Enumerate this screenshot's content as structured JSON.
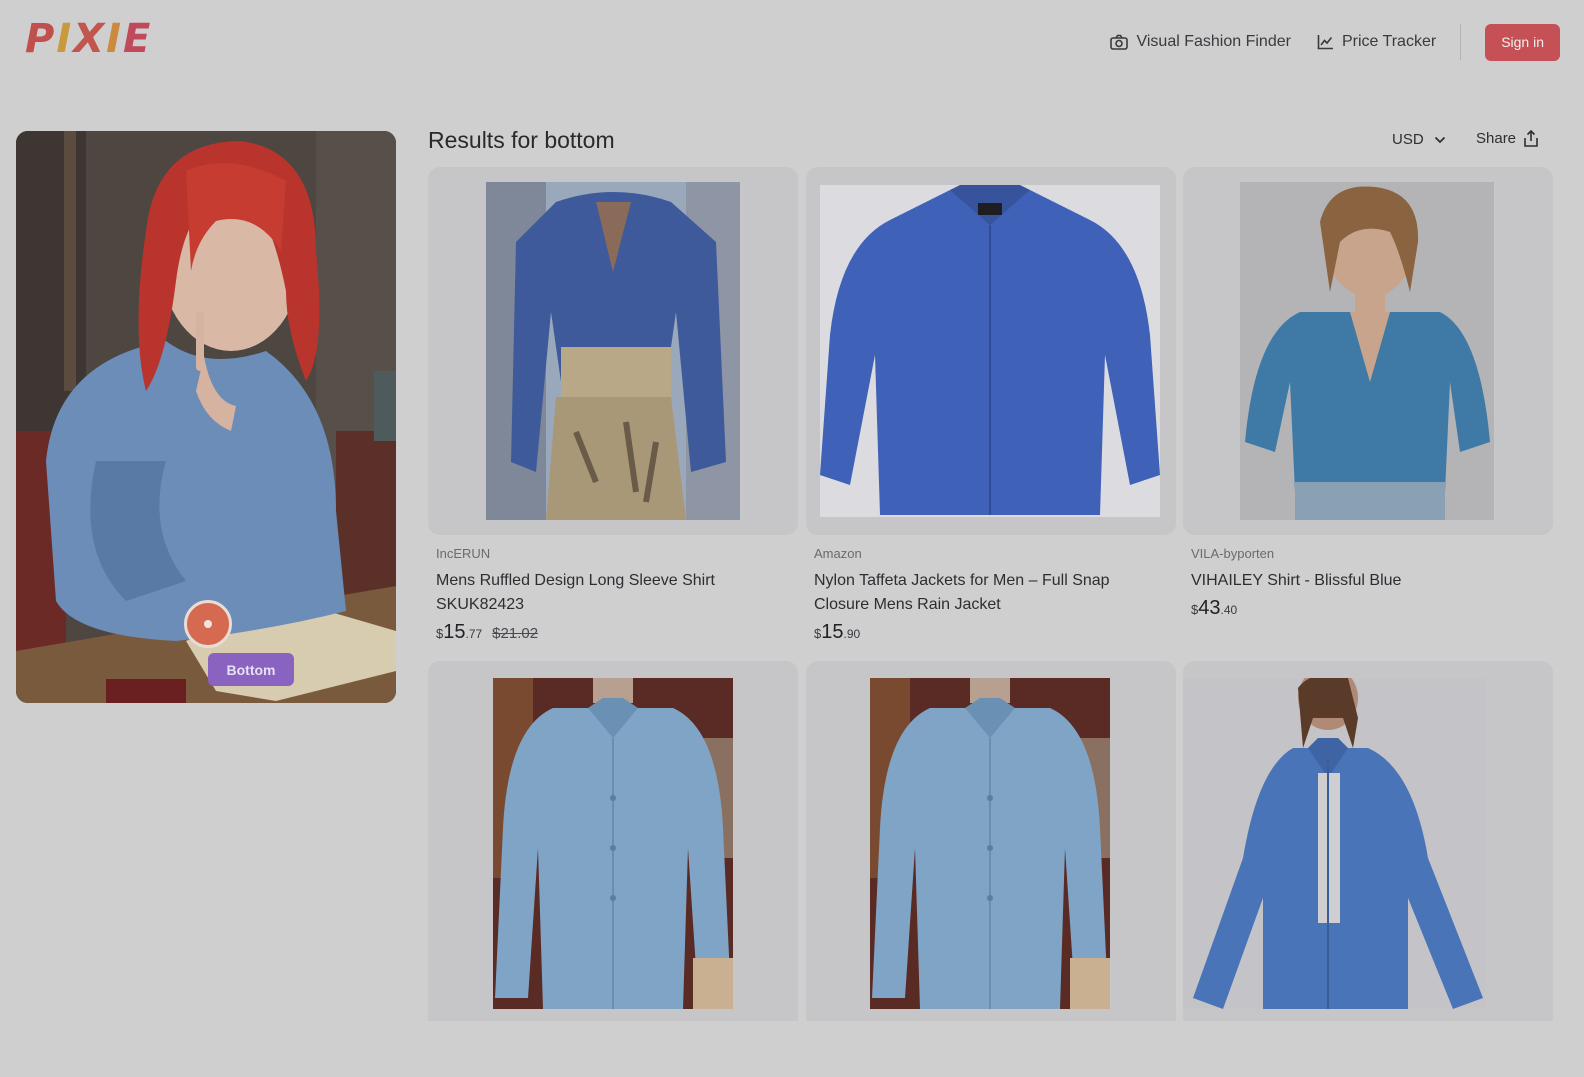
{
  "header": {
    "logo_letters": [
      "P",
      "I",
      "X",
      "I",
      "E"
    ],
    "logo_colors": [
      "#c0504e",
      "#c99a3c",
      "#c2564e",
      "#cc8a3e",
      "#c04a5a"
    ],
    "nav": [
      {
        "label": "Visual Fashion Finder",
        "icon": "camera-icon"
      },
      {
        "label": "Price Tracker",
        "icon": "chart-line-icon"
      }
    ],
    "signin_label": "Sign in"
  },
  "query": {
    "hotspot_label": "Bottom"
  },
  "results": {
    "title": "Results for bottom",
    "currency": "USD",
    "share_label": "Share",
    "products": [
      {
        "source": "IncERUN",
        "title": "Mens Ruffled Design Long Sleeve Shirt SKUK82423",
        "currency_symbol": "$",
        "price_int": "15",
        "price_dec": ".77",
        "price_old": "$21.02"
      },
      {
        "source": "Amazon",
        "title": "Nylon Taffeta Jackets for Men – Full Snap Closure Mens Rain Jacket",
        "currency_symbol": "$",
        "price_int": "15",
        "price_dec": ".90",
        "price_old": ""
      },
      {
        "source": "VILA-byporten",
        "title": "VIHAILEY Shirt - Blissful Blue",
        "currency_symbol": "$",
        "price_int": "43",
        "price_dec": ".40",
        "price_old": ""
      },
      {
        "source": "",
        "title": "",
        "currency_symbol": "",
        "price_int": "",
        "price_dec": "",
        "price_old": ""
      },
      {
        "source": "",
        "title": "",
        "currency_symbol": "",
        "price_int": "",
        "price_dec": "",
        "price_old": ""
      },
      {
        "source": "",
        "title": "",
        "currency_symbol": "",
        "price_int": "",
        "price_dec": "",
        "price_old": ""
      }
    ]
  }
}
